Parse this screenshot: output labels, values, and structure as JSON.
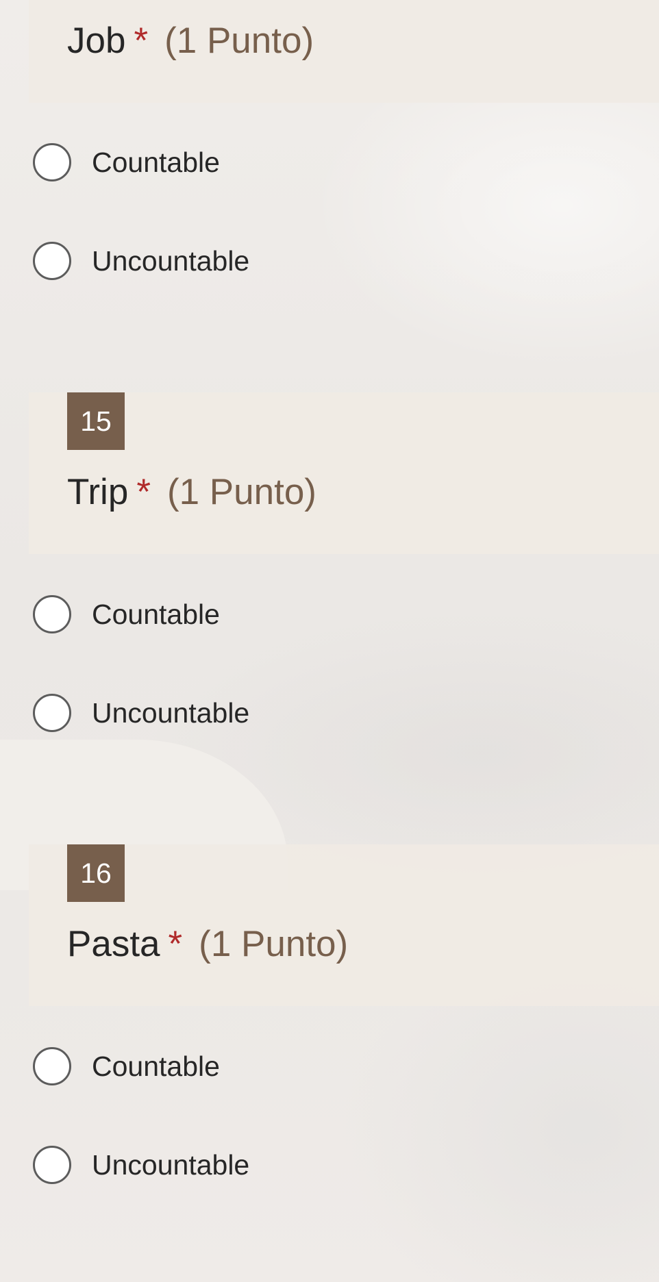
{
  "colors": {
    "accent_brown": "#775f4c",
    "required_star": "#b02a2a",
    "header_bg": "#f0eae4",
    "page_bg": "#efebe7",
    "text": "#262626"
  },
  "questions": [
    {
      "number": "",
      "title": "Job",
      "required_marker": "*",
      "points": "(1 Punto)",
      "options": [
        {
          "label": "Countable",
          "selected": false
        },
        {
          "label": "Uncountable",
          "selected": false
        }
      ]
    },
    {
      "number": "15",
      "title": "Trip",
      "required_marker": "*",
      "points": "(1 Punto)",
      "options": [
        {
          "label": "Countable",
          "selected": false
        },
        {
          "label": "Uncountable",
          "selected": false
        }
      ]
    },
    {
      "number": "16",
      "title": "Pasta",
      "required_marker": "*",
      "points": "(1 Punto)",
      "options": [
        {
          "label": "Countable",
          "selected": false
        },
        {
          "label": "Uncountable",
          "selected": false
        }
      ]
    }
  ]
}
